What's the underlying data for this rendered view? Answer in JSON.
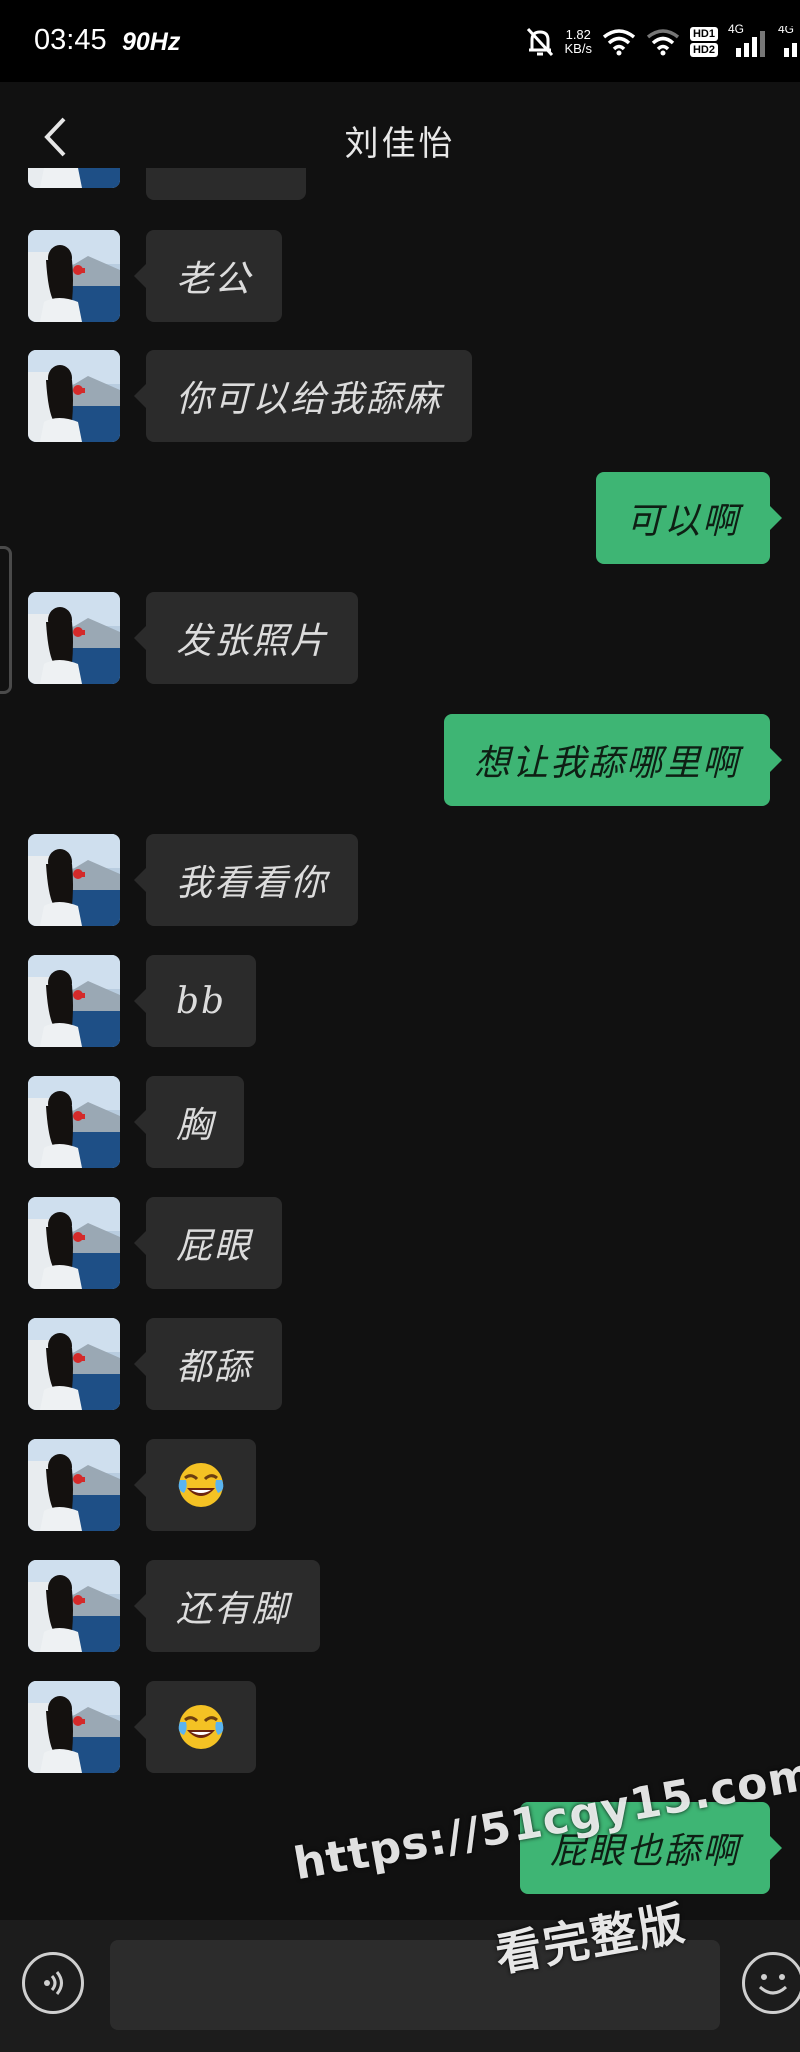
{
  "status_bar": {
    "time": "03:45",
    "refresh_rate": "90Hz",
    "net_speed_value": "1.82",
    "net_speed_unit": "KB/s",
    "hd1": "HD1",
    "hd2": "HD2",
    "signal1": "4G",
    "signal2": "4G"
  },
  "header": {
    "title": "刘佳怡",
    "back_icon": "chevron-left-icon"
  },
  "messages": [
    {
      "side": "left",
      "text": "老公"
    },
    {
      "side": "left",
      "text": "你可以给我舔麻"
    },
    {
      "side": "right",
      "text": "可以啊"
    },
    {
      "side": "left",
      "text": "发张照片"
    },
    {
      "side": "right",
      "text": "想让我舔哪里啊"
    },
    {
      "side": "left",
      "text": "我看看你"
    },
    {
      "side": "left",
      "text": "bb"
    },
    {
      "side": "left",
      "text": "胸"
    },
    {
      "side": "left",
      "text": "屁眼"
    },
    {
      "side": "left",
      "text": "都舔"
    },
    {
      "side": "left",
      "emoji": "face-with-tears-of-joy"
    },
    {
      "side": "left",
      "text": "还有脚"
    },
    {
      "side": "left",
      "emoji": "face-with-tears-of-joy"
    },
    {
      "side": "right",
      "text": "屁眼也舔啊"
    }
  ],
  "input_bar": {
    "voice_icon": "voice-icon",
    "input_value": "",
    "emoji_icon": "emoji-icon"
  },
  "watermark": {
    "url": "https://51cgy15.com",
    "text": "看完整版"
  },
  "colors": {
    "background": "#111111",
    "incoming_bubble": "#2b2b2b",
    "outgoing_bubble": "#3eb574",
    "input_bar": "#1c1c1c"
  }
}
